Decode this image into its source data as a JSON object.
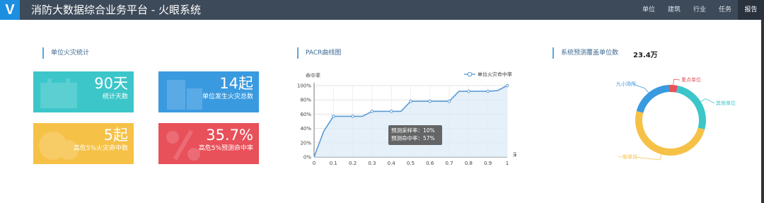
{
  "app": {
    "logo_letter": "V",
    "title": "消防大数据综合业务平台 - 火眼系统"
  },
  "nav": {
    "items": [
      {
        "label": "单位"
      },
      {
        "label": "建筑"
      },
      {
        "label": "行业"
      },
      {
        "label": "任务"
      },
      {
        "label": "报告"
      }
    ],
    "active_index": 4
  },
  "fire_stats": {
    "section_title": "单位火灾统计",
    "tiles": [
      {
        "value": "90天",
        "label": "统计天数",
        "color": "#3cc6c9"
      },
      {
        "value": "14起",
        "label": "单位发生火灾总数",
        "color": "#3a9ae0"
      },
      {
        "value": "5起",
        "label": "高危5%火灾命中数",
        "color": "#f6c147"
      },
      {
        "value": "35.7%",
        "label": "高危5%预测命中率",
        "color": "#e8505a"
      }
    ]
  },
  "pacr": {
    "section_title": "PACR曲线图"
  },
  "coverage": {
    "section_title": "系统预测覆盖单位数",
    "total": "23.4万"
  },
  "chart_data": [
    {
      "type": "area",
      "ylabel": "命中率",
      "xlabel": "采样率",
      "legend": "单位火灾命中率",
      "legend_position": "top-right",
      "x_ticks": [
        "0",
        "0.1",
        "0.2",
        "0.3",
        "0.4",
        "0.5",
        "0.6",
        "0.7",
        "0.8",
        "0.9",
        "1"
      ],
      "y_ticks": [
        "0%",
        "20%",
        "40%",
        "60%",
        "80%",
        "100%"
      ],
      "xlim": [
        0,
        1
      ],
      "ylim": [
        0,
        100
      ],
      "x": [
        0,
        0.05,
        0.1,
        0.2,
        0.25,
        0.3,
        0.4,
        0.45,
        0.5,
        0.55,
        0.6,
        0.7,
        0.75,
        0.8,
        0.9,
        0.95,
        1.0
      ],
      "values": [
        0,
        36,
        57,
        57,
        57,
        64,
        64,
        64,
        78,
        78,
        78,
        78,
        92,
        92,
        92,
        93,
        100
      ],
      "marker_x": [
        0.1,
        0.2,
        0.3,
        0.4,
        0.5,
        0.6,
        0.7,
        0.8,
        0.9,
        1.0
      ],
      "color": "#5b9bd5",
      "grid": true,
      "tooltip": {
        "lines": [
          "预测采样率：10%",
          "预测命中率：57%"
        ]
      }
    },
    {
      "type": "pie",
      "donut": true,
      "categories": [
        "重点单位",
        "其他单位",
        "一般单位",
        "九小场所"
      ],
      "values": [
        4,
        26,
        50,
        20
      ],
      "colors": [
        "#e8505a",
        "#3cc6c9",
        "#f6c147",
        "#3a9ae0"
      ]
    }
  ]
}
